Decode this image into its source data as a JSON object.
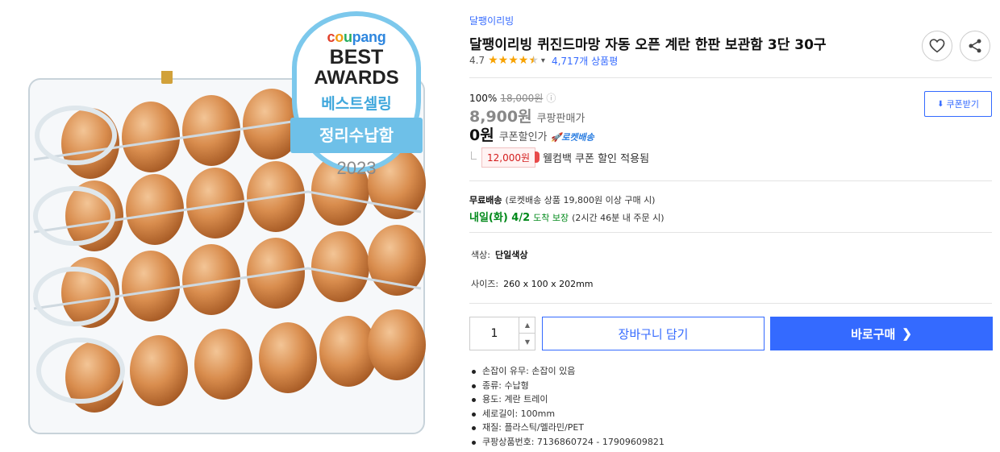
{
  "product": {
    "brand": "달팽이리빙",
    "title": "달팽이리빙 퀴진드마망 자동 오픈 계란 한판 보관함 3단 30구",
    "rating_value": "4.7",
    "rating_stars": 4.5,
    "review_count": "4,717개 상품평"
  },
  "award_badge": {
    "logo_parts": [
      "c",
      "o",
      "u",
      "pang"
    ],
    "line1": "BEST",
    "line2": "AWARDS",
    "line3": "베스트셀링",
    "banner": "정리수납함",
    "year": "2023"
  },
  "pricing": {
    "discount_rate": "100%",
    "original_price": "18,000원",
    "info_icon": "ⓘ",
    "sale_price": "8,900원",
    "sale_label": "쿠팡판매가",
    "coupon_price": "0원",
    "coupon_label": "쿠폰할인가",
    "rocket_label": "🚀로켓배송",
    "welcome_amount": "12,000원",
    "welcome_text": "웰컴백 쿠폰 할인 적용됨",
    "coupon_button": "쿠폰받기",
    "coupon_button_icon": "download-icon"
  },
  "shipping": {
    "free_label": "무료배송",
    "free_detail": "(로켓배송 상품 19,800원 이상 구매 시)",
    "arrival": "내일(화) 4/2",
    "arrival_guarantee": "도착 보장",
    "cutoff": "(2시간 46분 내 주문 시)"
  },
  "options": {
    "color_label": "색상:",
    "color_value": "단일색상",
    "size_label": "사이즈:",
    "size_value": "260 x 100 x 202mm"
  },
  "purchase": {
    "quantity": "1",
    "cart_label": "장바구니 담기",
    "buy_label": "바로구매",
    "buy_arrow": "❯"
  },
  "specs": [
    "손잡이 유무: 손잡이 있음",
    "종류: 수납형",
    "용도: 계란 트레이",
    "세로길이: 100mm",
    "재질: 플라스틱/멜라민/PET",
    "쿠팡상품번호: 7136860724 - 17909609821"
  ],
  "icons": {
    "heart": "heart-icon",
    "share": "share-icon",
    "rating_dropdown": "chevron-down-icon",
    "qty_up": "chevron-up-icon",
    "qty_down": "chevron-down-icon"
  },
  "colors": {
    "accent": "#346aff",
    "green": "#00891a",
    "red": "#d41c1c",
    "star": "#f8a200",
    "award_blue": "#6ec0e8"
  }
}
